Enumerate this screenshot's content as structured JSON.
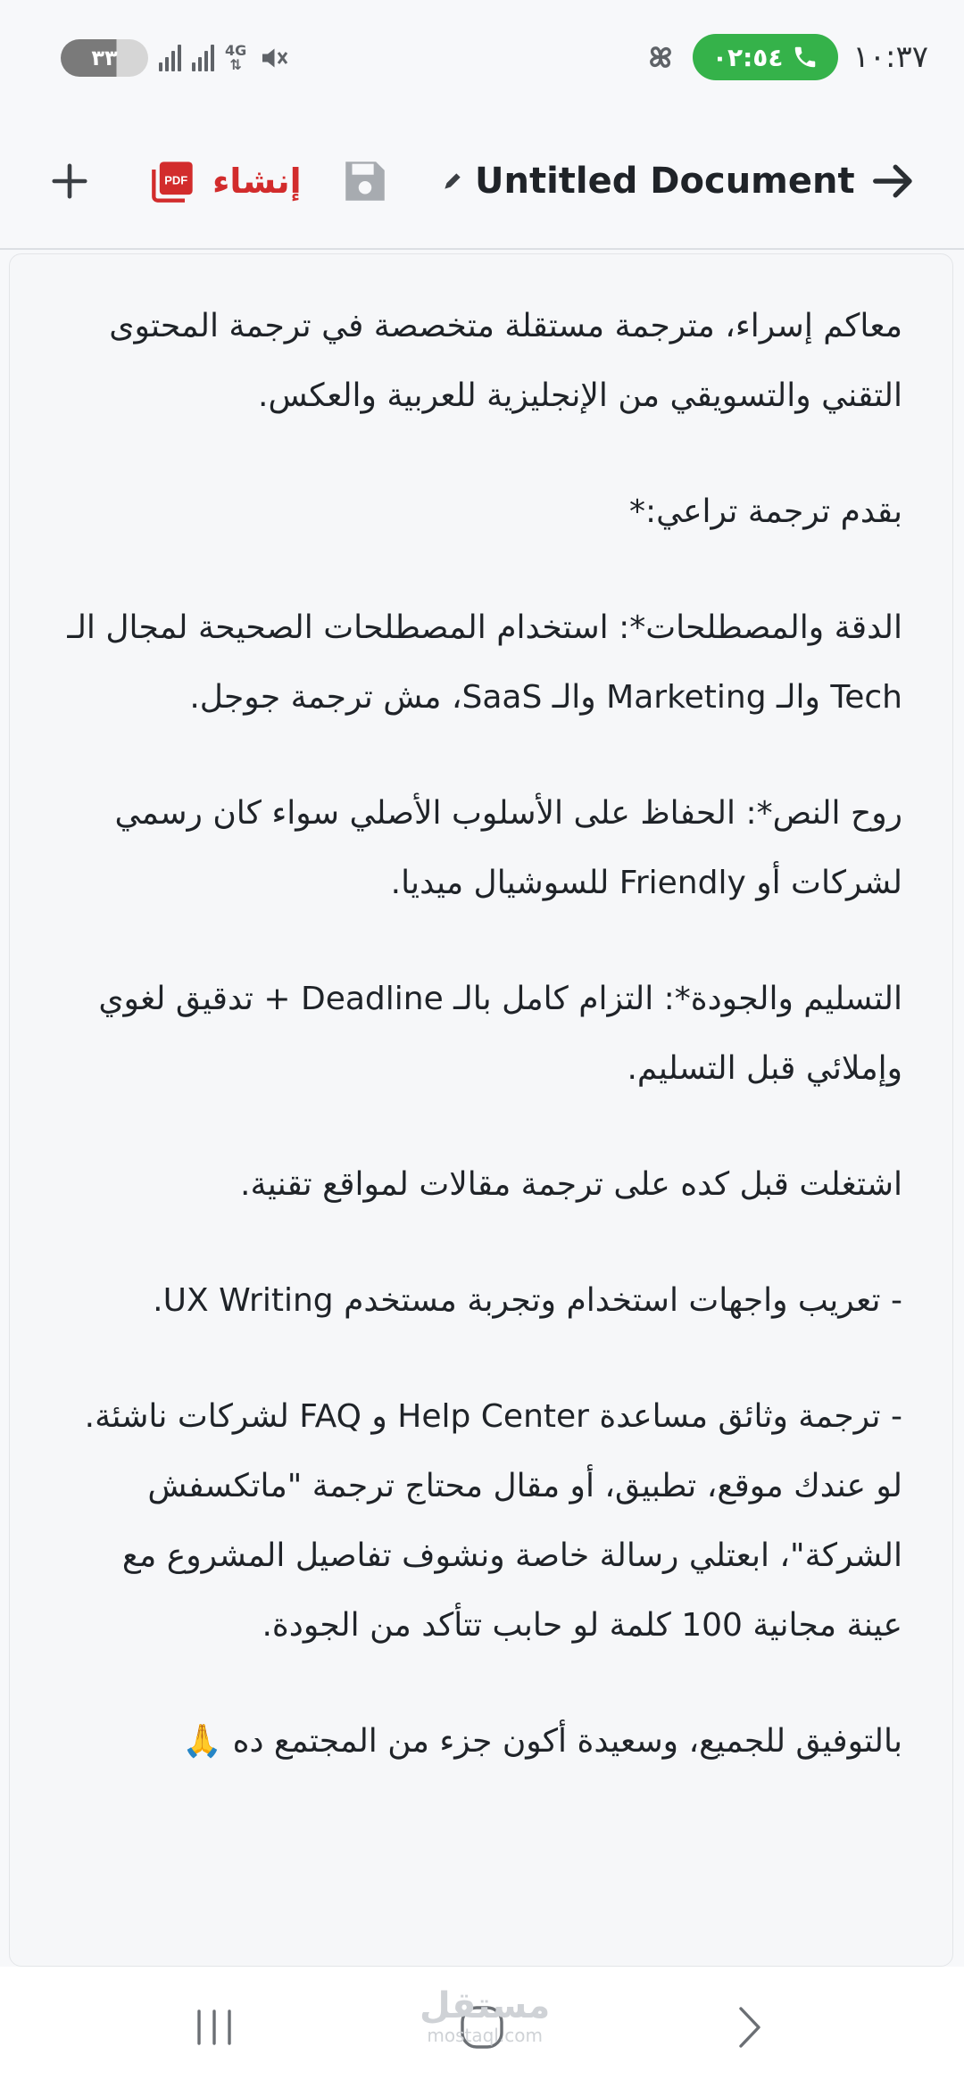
{
  "status_bar": {
    "time": "١٠:٣٧",
    "call_timer": "٠٢:٥٤",
    "battery": "٣٣",
    "network": "4G"
  },
  "toolbar": {
    "title": "Untitled Document",
    "create_label": "إنشاء",
    "pdf_badge": "PDF"
  },
  "document": {
    "paragraphs": [
      "معاكم إسراء، مترجمة مستقلة متخصصة في ترجمة المحتوى التقني والتسويقي من الإنجليزية للعربية والعكس.",
      "بقدم ترجمة تراعي:*",
      "الدقة والمصطلحات*: استخدام المصطلحات الصحيحة لمجال الـ Tech والـ Marketing والـ SaaS، مش ترجمة جوجل.",
      "روح النص*: الحفاظ على الأسلوب الأصلي سواء كان رسمي لشركات أو Friendly للسوشيال ميديا.",
      "التسليم والجودة*: التزام كامل بالـ Deadline + تدقيق لغوي وإملائي قبل التسليم.",
      "اشتغلت قبل كده على ترجمة مقالات لمواقع تقنية.",
      "- تعريب واجهات استخدام وتجربة مستخدم UX Writing.",
      "- ترجمة وثائق مساعدة Help Center و FAQ لشركات ناشئة. لو عندك موقع، تطبيق، أو مقال محتاج ترجمة \"ماتكسفش الشركة\"، ابعتلي رسالة خاصة ونشوف تفاصيل المشروع مع عينة مجانية 100 كلمة لو حابب تتأكد من الجودة.",
      "بالتوفيق للجميع، وسعيدة أكون جزء من المجتمع ده 🙏"
    ]
  },
  "watermark": {
    "arabic": "مستقل",
    "latin": "mostaql.com"
  },
  "colors": {
    "accent_pdf": "#d22c2c",
    "call_green": "#35b24a",
    "text": "#1f2328"
  },
  "icons": [
    "back-arrow-icon",
    "pencil-icon",
    "save-icon",
    "pdf-icon",
    "plus-icon",
    "call-icon",
    "pinwheel-icon",
    "mute-icon",
    "recent-apps-icon",
    "home-icon",
    "back-nav-icon"
  ]
}
